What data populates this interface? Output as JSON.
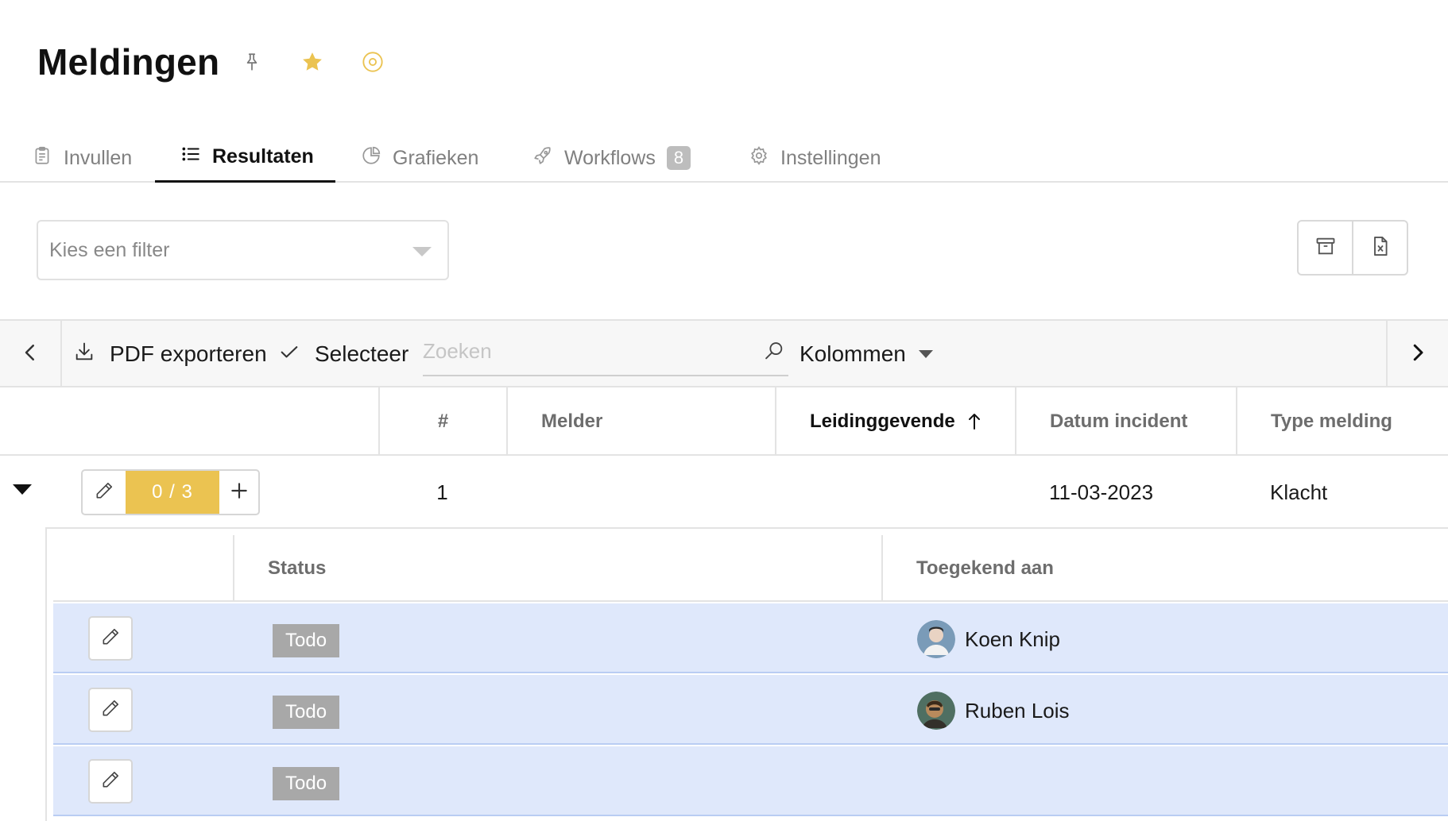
{
  "header": {
    "title": "Meldingen",
    "icons": [
      "pin-icon",
      "star-icon",
      "target-icon"
    ],
    "accent_color": "#ebc351"
  },
  "tabs": [
    {
      "label": "Invullen",
      "icon": "clipboard-icon",
      "active": false
    },
    {
      "label": "Resultaten",
      "icon": "list-icon",
      "active": true
    },
    {
      "label": "Grafieken",
      "icon": "pie-chart-icon",
      "active": false
    },
    {
      "label": "Workflows",
      "icon": "rocket-icon",
      "active": false,
      "badge": "8"
    },
    {
      "label": "Instellingen",
      "icon": "gear-icon",
      "active": false
    }
  ],
  "filter": {
    "placeholder": "Kies een filter"
  },
  "toolbar": {
    "pdf_label": "PDF exporteren",
    "select_label": "Selecteer",
    "search_placeholder": "Zoeken",
    "columns_label": "Kolommen"
  },
  "table": {
    "columns": [
      "#",
      "Melder",
      "Leidinggevende",
      "Datum incident",
      "Type melding"
    ],
    "sorted_column": "Leidinggevende",
    "rows": [
      {
        "number": "1",
        "melder": "",
        "leidinggevende": "",
        "datum": "11-03-2023",
        "type": "Klacht",
        "progress": "0 / 3"
      }
    ]
  },
  "subtable": {
    "columns": [
      "Status",
      "Toegekend aan"
    ],
    "rows": [
      {
        "status": "Todo",
        "assignee": "Koen Knip"
      },
      {
        "status": "Todo",
        "assignee": "Ruben Lois"
      },
      {
        "status": "Todo",
        "assignee": ""
      }
    ]
  }
}
